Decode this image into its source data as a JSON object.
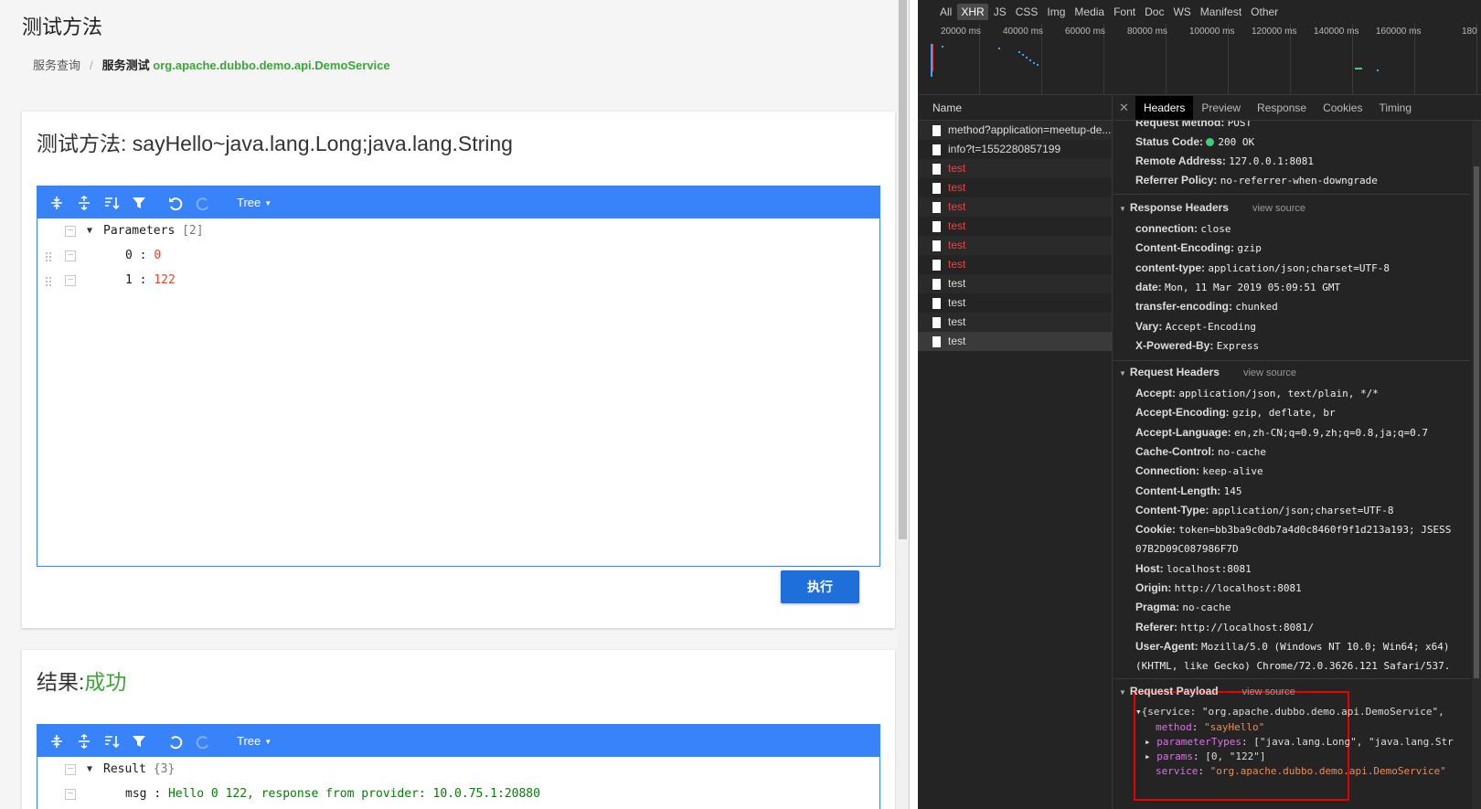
{
  "app": {
    "page_title": "测试方法",
    "breadcrumb": {
      "parent": "服务查询",
      "separator": "/",
      "current": "服务测试",
      "service": "org.apache.dubbo.demo.api.DemoService"
    },
    "method_card": {
      "title": "测试方法: sayHello~java.lang.Long;java.lang.String",
      "editor": {
        "mode_label": "Tree",
        "root_field": "Parameters",
        "root_meta": "[2]",
        "rows": [
          {
            "field": "0",
            "value": "0"
          },
          {
            "field": "1",
            "value": "122"
          }
        ]
      },
      "run_button": "执行"
    },
    "result_card": {
      "title_prefix": "结果:",
      "title_status": "成功",
      "editor": {
        "mode_label": "Tree",
        "root_field": "Result",
        "root_meta": "{3}",
        "rows": [
          {
            "field": "msg",
            "value": "Hello 0 122, response from provider: 10.0.75.1:20880"
          }
        ]
      }
    }
  },
  "devtools": {
    "filters": [
      "All",
      "XHR",
      "JS",
      "CSS",
      "Img",
      "Media",
      "Font",
      "Doc",
      "WS",
      "Manifest",
      "Other"
    ],
    "active_filter": "XHR",
    "timeline_ticks": [
      "20000 ms",
      "40000 ms",
      "60000 ms",
      "80000 ms",
      "100000 ms",
      "120000 ms",
      "140000 ms",
      "160000 ms",
      "180"
    ],
    "name_header": "Name",
    "requests": [
      {
        "name": "method?application=meetup-de...",
        "error": false
      },
      {
        "name": "info?t=1552280857199",
        "error": false
      },
      {
        "name": "test",
        "error": true
      },
      {
        "name": "test",
        "error": true
      },
      {
        "name": "test",
        "error": true
      },
      {
        "name": "test",
        "error": true
      },
      {
        "name": "test",
        "error": true
      },
      {
        "name": "test",
        "error": true
      },
      {
        "name": "test",
        "error": false
      },
      {
        "name": "test",
        "error": false
      },
      {
        "name": "test",
        "error": false
      },
      {
        "name": "test",
        "error": false
      }
    ],
    "tabs": [
      "Headers",
      "Preview",
      "Response",
      "Cookies",
      "Timing"
    ],
    "active_tab": "Headers",
    "general": [
      {
        "k": "Request Method:",
        "v": "POST"
      },
      {
        "k": "Status Code:",
        "v": "200 OK"
      },
      {
        "k": "Remote Address:",
        "v": "127.0.0.1:8081"
      },
      {
        "k": "Referrer Policy:",
        "v": "no-referrer-when-downgrade"
      }
    ],
    "response_headers_title": "Response Headers",
    "view_source": "view source",
    "response_headers": [
      {
        "k": "connection:",
        "v": "close"
      },
      {
        "k": "Content-Encoding:",
        "v": "gzip"
      },
      {
        "k": "content-type:",
        "v": "application/json;charset=UTF-8"
      },
      {
        "k": "date:",
        "v": "Mon, 11 Mar 2019 05:09:51 GMT"
      },
      {
        "k": "transfer-encoding:",
        "v": "chunked"
      },
      {
        "k": "Vary:",
        "v": "Accept-Encoding"
      },
      {
        "k": "X-Powered-By:",
        "v": "Express"
      }
    ],
    "request_headers_title": "Request Headers",
    "request_headers": [
      {
        "k": "Accept:",
        "v": "application/json, text/plain, */*"
      },
      {
        "k": "Accept-Encoding:",
        "v": "gzip, deflate, br"
      },
      {
        "k": "Accept-Language:",
        "v": "en,zh-CN;q=0.9,zh;q=0.8,ja;q=0.7"
      },
      {
        "k": "Cache-Control:",
        "v": "no-cache"
      },
      {
        "k": "Connection:",
        "v": "keep-alive"
      },
      {
        "k": "Content-Length:",
        "v": "145"
      },
      {
        "k": "Content-Type:",
        "v": "application/json;charset=UTF-8"
      },
      {
        "k": "Cookie:",
        "v": "token=bb3ba9c0db7a4d0c8460f9f1d213a193; JSESS"
      },
      {
        "k": "",
        "v": "07B2D09C087986F7D"
      },
      {
        "k": "Host:",
        "v": "localhost:8081"
      },
      {
        "k": "Origin:",
        "v": "http://localhost:8081"
      },
      {
        "k": "Pragma:",
        "v": "no-cache"
      },
      {
        "k": "Referer:",
        "v": "http://localhost:8081/"
      },
      {
        "k": "User-Agent:",
        "v": "Mozilla/5.0 (Windows NT 10.0; Win64; x64)"
      },
      {
        "k": "",
        "v": "(KHTML, like Gecko) Chrome/72.0.3626.121 Safari/537."
      }
    ],
    "payload_title": "Request Payload",
    "payload": {
      "line1": "{service: \"org.apache.dubbo.demo.api.DemoService\",",
      "method_key": "method",
      "method_val": "\"sayHello\"",
      "ptypes_key": "parameterTypes",
      "ptypes_val": "[\"java.lang.Long\", \"java.lang.Str",
      "params_key": "params",
      "params_val": "[0, \"122\"]",
      "service_key": "service",
      "service_val": "\"org.apache.dubbo.demo.api.DemoService\""
    },
    "colors": {
      "status_ok": "#3bd07a",
      "highlight_box": "#e60000",
      "accent": "#3883fa"
    }
  }
}
